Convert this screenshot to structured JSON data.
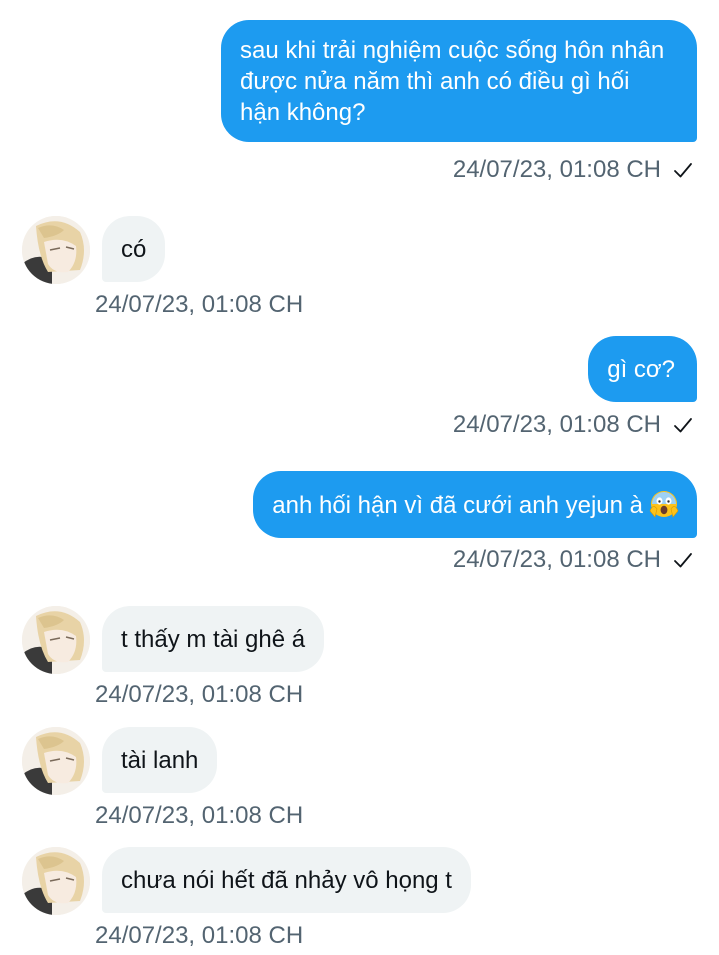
{
  "conversation": {
    "messages": [
      {
        "direction": "sent",
        "text": "sau khi trải nghiệm cuộc sống hôn nhân được nửa năm thì anh có điều gì hối hận không?",
        "timestamp": "24/07/23, 01:08 CH"
      },
      {
        "direction": "received",
        "text": "có",
        "timestamp": "24/07/23, 01:08 CH"
      },
      {
        "direction": "sent",
        "text": "gì cơ?",
        "timestamp": "24/07/23, 01:08 CH"
      },
      {
        "direction": "sent",
        "text": "anh hối hận vì đã cưới anh yejun à",
        "emoji": "face-screaming-in-fear",
        "timestamp": "24/07/23, 01:08 CH"
      },
      {
        "direction": "received",
        "text": "t thấy m tài ghê á",
        "timestamp": "24/07/23, 01:08 CH"
      },
      {
        "direction": "received",
        "text": "tài lanh",
        "timestamp": "24/07/23, 01:08 CH"
      },
      {
        "direction": "received",
        "text": "chưa nói hết đã nhảy vô họng t",
        "timestamp": "24/07/23, 01:08 CH"
      }
    ]
  },
  "colors": {
    "sent_bubble": "#1d9bf0",
    "received_bubble": "#eff3f4",
    "timestamp_text": "#536471"
  },
  "icons": {
    "read_receipt": "check-icon",
    "avatar": "avatar-blonde-illustration"
  }
}
